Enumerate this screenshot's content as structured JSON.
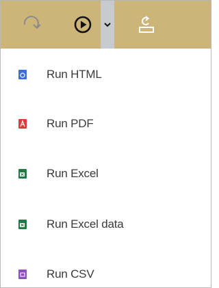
{
  "toolbar": {
    "icons": {
      "redo": "redo-arrow-icon",
      "run": "play-circle-icon",
      "dropdown": "chevron-down-icon",
      "export": "export-upload-icon"
    },
    "colors": {
      "background": "#cdb57a",
      "dropdown_bg": "#c7cbd0",
      "icon_active": "#111111",
      "icon_muted": "#8a8a8a",
      "icon_light": "#ffffff"
    }
  },
  "menu": {
    "items": [
      {
        "label": "Run HTML",
        "icon": "html-file-icon",
        "color": "#3b6fd6"
      },
      {
        "label": "Run PDF",
        "icon": "pdf-file-icon",
        "color": "#e23a3a"
      },
      {
        "label": "Run Excel",
        "icon": "excel-file-icon",
        "color": "#1f7a45"
      },
      {
        "label": "Run Excel data",
        "icon": "excel-data-file-icon",
        "color": "#1f7a45"
      },
      {
        "label": "Run CSV",
        "icon": "csv-file-icon",
        "color": "#8e4fbf"
      }
    ]
  }
}
